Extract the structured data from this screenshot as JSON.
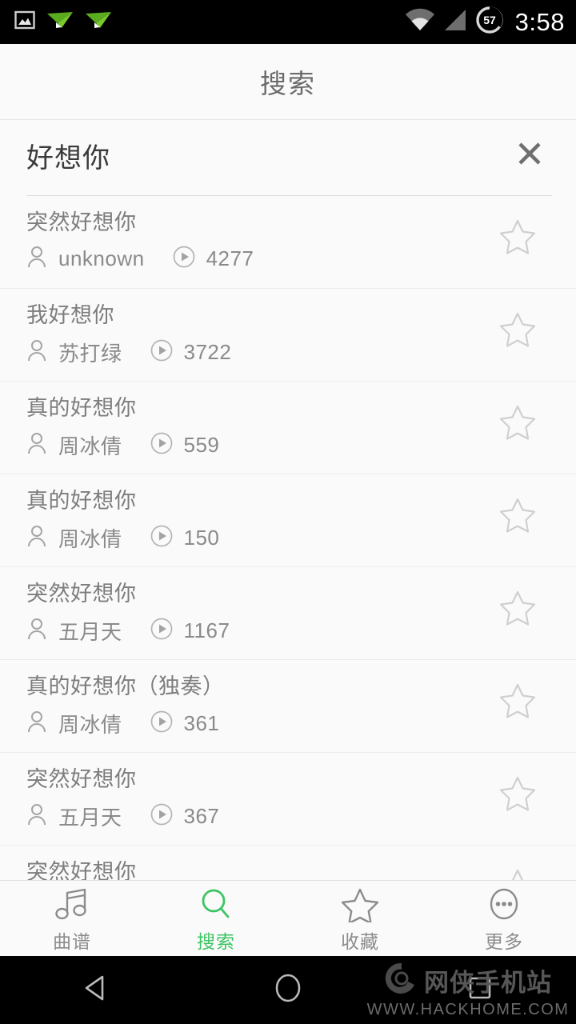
{
  "statusbar": {
    "time": "3:58",
    "battery_level": "57",
    "icons": [
      "screenshot-icon",
      "paper-plane-icon",
      "paper-plane-icon",
      "wifi-icon",
      "cellular-signal-icon",
      "battery-icon"
    ]
  },
  "header": {
    "title": "搜索"
  },
  "search": {
    "value": "好想你",
    "placeholder": "",
    "clear_label": "✕"
  },
  "results": [
    {
      "title": "突然好想你",
      "artist": "unknown",
      "plays": "4277",
      "starred": false
    },
    {
      "title": "我好想你",
      "artist": "苏打绿",
      "plays": "3722",
      "starred": false
    },
    {
      "title": "真的好想你",
      "artist": "周冰倩",
      "plays": "559",
      "starred": false
    },
    {
      "title": "真的好想你",
      "artist": "周冰倩",
      "plays": "150",
      "starred": false
    },
    {
      "title": "突然好想你",
      "artist": "五月天",
      "plays": "1167",
      "starred": false
    },
    {
      "title": "真的好想你（独奏）",
      "artist": "周冰倩",
      "plays": "361",
      "starred": false
    },
    {
      "title": "突然好想你",
      "artist": "五月天",
      "plays": "367",
      "starred": false
    },
    {
      "title": "突然好想你",
      "artist": "",
      "plays": "",
      "starred": false
    }
  ],
  "tabs": [
    {
      "label": "曲谱",
      "icon": "music-note-icon",
      "active": false
    },
    {
      "label": "搜索",
      "icon": "search-icon",
      "active": true
    },
    {
      "label": "收藏",
      "icon": "star-icon",
      "active": false
    },
    {
      "label": "更多",
      "icon": "more-ellipsis-icon",
      "active": false
    }
  ],
  "navbar": {
    "back": "back-icon",
    "home": "home-icon",
    "recents": "recents-icon"
  },
  "watermark": {
    "site_cn": "网侠手机站",
    "site_url": "WWW.HACKHOME.COM"
  },
  "colors": {
    "accent_green": "#3dc463",
    "page_bg": "#fafafa",
    "text_primary": "#7d7d7d",
    "text_secondary": "#8a8a8a",
    "divider": "#ececec",
    "statusbar_bg": "#000000"
  }
}
